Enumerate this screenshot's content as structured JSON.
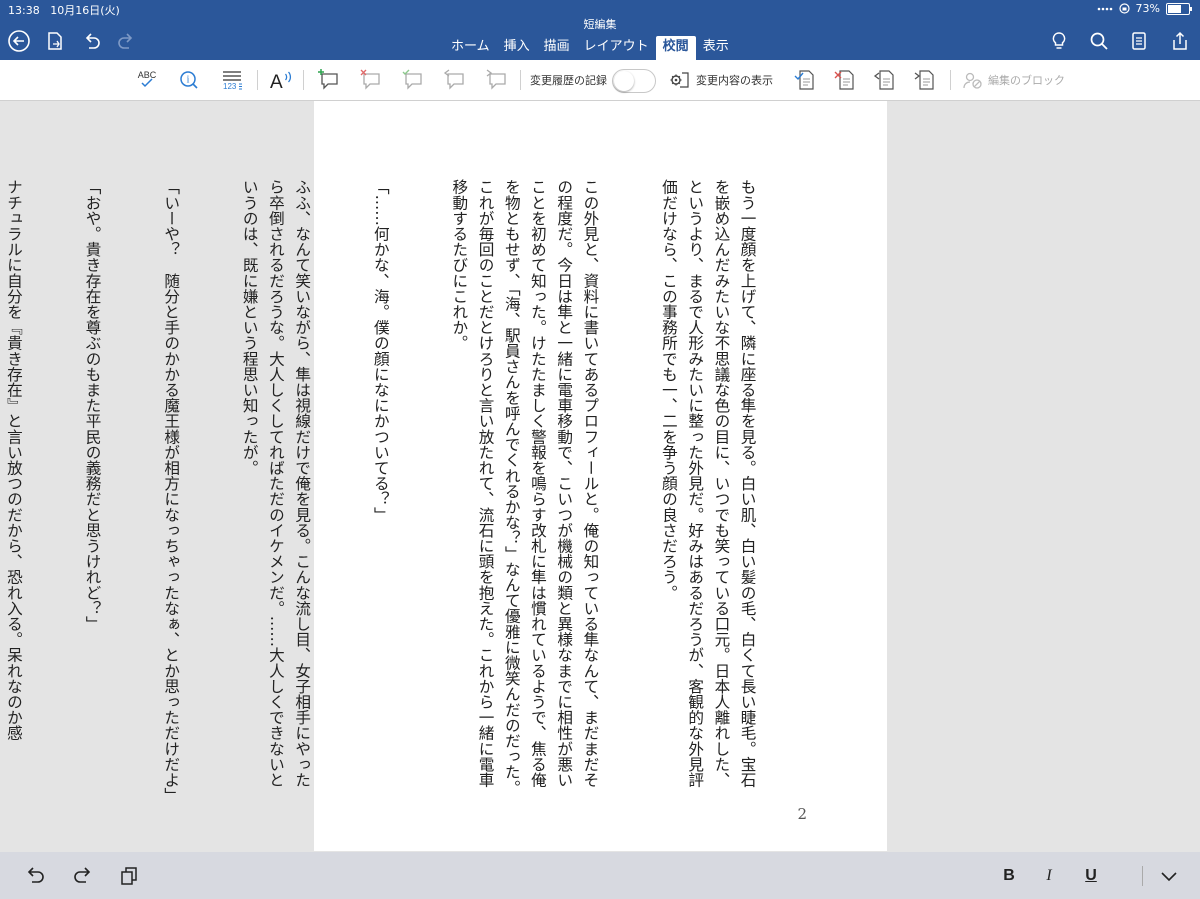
{
  "status": {
    "time": "13:38",
    "date": "10月16日(火)",
    "battery": "73%",
    "battery_level": 0.73
  },
  "titlebar": {
    "doc_title": "短編集"
  },
  "tabs": [
    {
      "label": "ホーム"
    },
    {
      "label": "挿入"
    },
    {
      "label": "描画"
    },
    {
      "label": "レイアウト"
    },
    {
      "label": "校閲",
      "active": true
    },
    {
      "label": "表示"
    }
  ],
  "ribbon": {
    "spell_label": "ABC",
    "wordcount_label": "123",
    "track_changes_label": "変更履歴の記録",
    "track_changes_on": false,
    "show_markup_label": "変更内容の表示",
    "block_authors_label": "編集のブロック"
  },
  "document": {
    "paragraphs": [
      "もう一度顔を上げて、隣に座る隼を見る。白い肌、白い髪の毛、白くて長い睫毛。宝石を嵌め込んだみたいな不思議な色の目に、いつでも笑っている口元。日本人離れした、というより、まるで人形みたいに整った外見だ。好みはあるだろうが、客観的な外見評価だけなら、この事務所でも一、二を争う顔の良さだろう。",
      "この外見と、資料に書いてあるプロフィールと。俺の知っている隼なんて、まだまだその程度だ。今日は隼と一緒に電車移動で、こいつが機械の類と異様なまでに相性が悪いことを初めて知った。けたたましく警報を鳴らす改札に隼は慣れているようで、焦る俺を物ともせず、「海、駅員さんを呼んでくれるかな？」なんて優雅に微笑んだのだった。これが毎回のことだとけろりと言い放たれて、流石に頭を抱えた。これから一緒に電車移動するたびにこれか。",
      "「……何かな、海。僕の顔になにかついてる？」",
      "ふふ、なんて笑いながら、隼は視線だけで俺を見る。こんな流し目、女子相手にやったら卒倒されるだろうな。大人しくしてればただのイケメンだ。……大人しくできないというのは、既に嫌という程思い知ったが。",
      "「いーや？　随分と手のかかる魔王様が相方になっちゃったなぁ、とか思っただけだよ」",
      "「おや。貴き存在を尊ぶのもまた平民の義務だと思うけれど？」",
      "ナチュラルに自分を『貴き存在』と言い放つのだから、恐れ入る。呆れなのか感"
    ],
    "page_number": "2"
  },
  "bottombar": {
    "bold_label": "B",
    "italic_label": "I",
    "underline_label": "U"
  }
}
